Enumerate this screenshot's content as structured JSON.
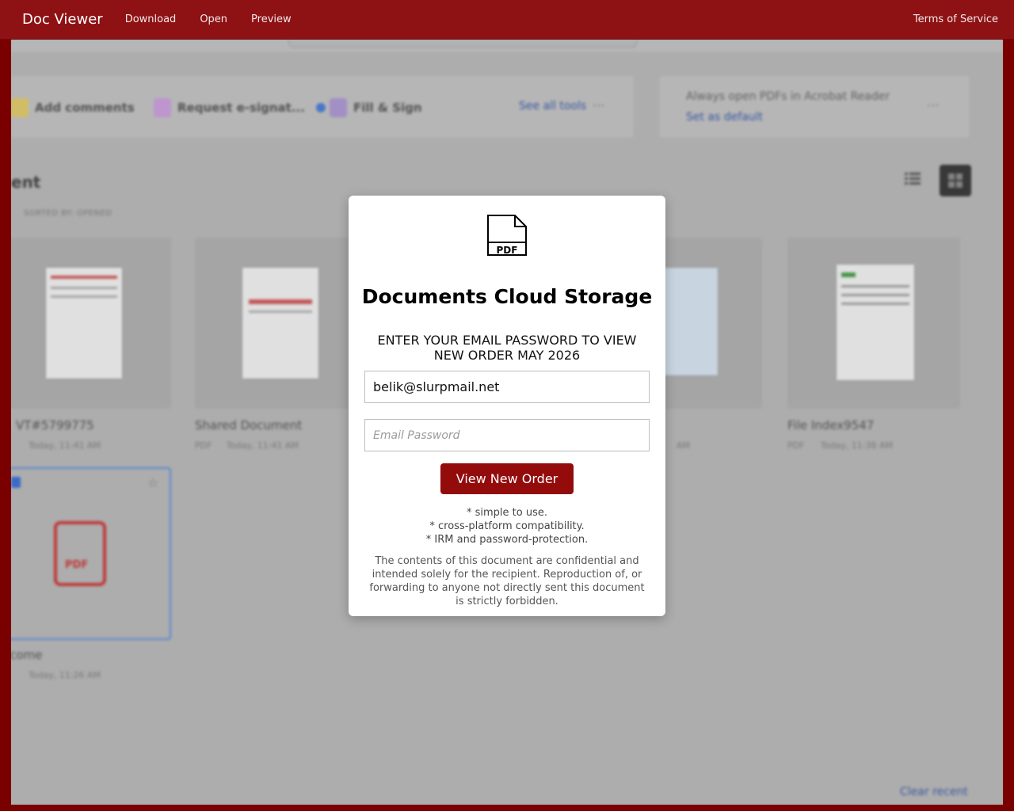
{
  "navbar": {
    "brand": "Doc Viewer",
    "links": [
      "Download",
      "Open",
      "Preview"
    ],
    "right_link": "Terms of Service",
    "color": "#8e1214"
  },
  "background": {
    "tools": [
      "Add comments",
      "Request e-signat...",
      "Fill & Sign"
    ],
    "see_all_tools": "See all tools",
    "default_prompt": "Always open PDFs in Acrobat Reader",
    "set_default": "Set as default",
    "heading": "ent",
    "sorted_by": "SORTED BY: OPENED",
    "cards": [
      {
        "title": "VT#5799775",
        "meta": "Today, 11:41 AM"
      },
      {
        "title": "Shared Document",
        "meta_type": "PDF",
        "meta": "Today, 11:41 AM"
      },
      {
        "title": "",
        "meta": "AM"
      },
      {
        "title": "File Index9547",
        "meta_type": "PDF",
        "meta": "Today, 11:38 AM"
      }
    ],
    "welcome": {
      "title": "lcome",
      "meta": "Today, 11:26 AM",
      "icon_label": "PDF"
    },
    "clear_recent": "Clear recent"
  },
  "modal": {
    "icon_label": "PDF",
    "title": "Documents Cloud Storage",
    "instruction": "ENTER YOUR EMAIL PASSWORD TO VIEW NEW ORDER MAY 2026",
    "email_value": "belik@slurpmail.net",
    "password_placeholder": "Email Password",
    "button_label": "View New Order",
    "button_color": "#930b0b",
    "features": [
      "* simple to use.",
      "* cross-platform compatibility.",
      "* IRM and password-protection."
    ],
    "disclaimer": "The contents of this document are confidential and intended solely for the recipient. Reproduction of, or forwarding to anyone not directly sent this document is strictly forbidden."
  }
}
